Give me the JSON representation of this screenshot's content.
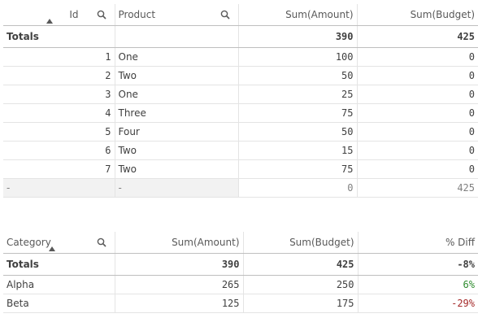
{
  "table1": {
    "headers": [
      "Id",
      "Product",
      "Sum(Amount)",
      "Sum(Budget)"
    ],
    "totals": {
      "label": "Totals",
      "amount": "390",
      "budget": "425"
    },
    "rows": [
      {
        "id": "1",
        "product": "One",
        "amount": "100",
        "budget": "0"
      },
      {
        "id": "2",
        "product": "Two",
        "amount": "50",
        "budget": "0"
      },
      {
        "id": "3",
        "product": "One",
        "amount": "25",
        "budget": "0"
      },
      {
        "id": "4",
        "product": "Three",
        "amount": "75",
        "budget": "0"
      },
      {
        "id": "5",
        "product": "Four",
        "amount": "50",
        "budget": "0"
      },
      {
        "id": "6",
        "product": "Two",
        "amount": "15",
        "budget": "0"
      },
      {
        "id": "7",
        "product": "Two",
        "amount": "75",
        "budget": "0"
      }
    ],
    "null_row": {
      "id": "-",
      "product": "-",
      "amount": "0",
      "budget": "425"
    }
  },
  "table2": {
    "headers": [
      "Category",
      "Sum(Amount)",
      "Sum(Budget)",
      "% Diff"
    ],
    "totals": {
      "label": "Totals",
      "amount": "390",
      "budget": "425",
      "diff": "-8%"
    },
    "rows": [
      {
        "category": "Alpha",
        "amount": "265",
        "budget": "250",
        "diff": "6%"
      },
      {
        "category": "Beta",
        "amount": "125",
        "budget": "175",
        "diff": "-29%"
      }
    ]
  },
  "colors": {
    "positive": "#2e8b2e",
    "negative": "#a52a2a"
  }
}
